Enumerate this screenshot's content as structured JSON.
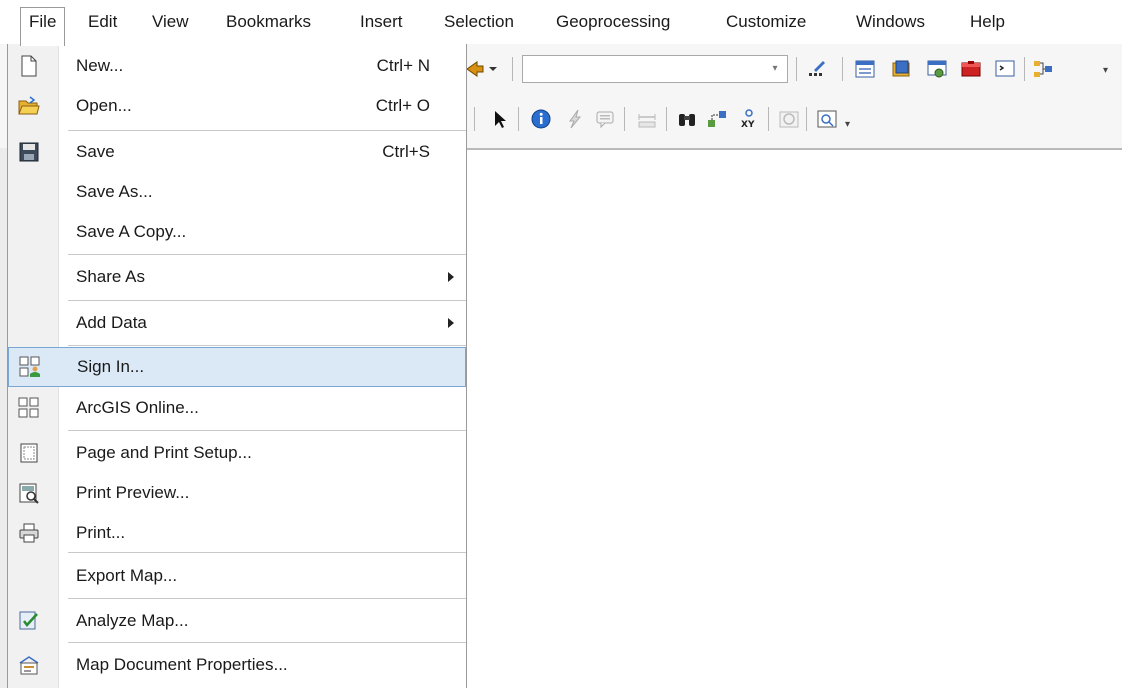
{
  "menubar": {
    "items": [
      "File",
      "Edit",
      "View",
      "Bookmarks",
      "Insert",
      "Selection",
      "Geoprocessing",
      "Customize",
      "Windows",
      "Help"
    ]
  },
  "toolbar": {
    "combo_value": ""
  },
  "file_menu": {
    "items": [
      {
        "label": "New...",
        "shortcut": "Ctrl+ N",
        "icon": "new-document-icon"
      },
      {
        "label": "Open...",
        "shortcut": "Ctrl+ O",
        "icon": "open-folder-icon"
      },
      {
        "label": "Save",
        "shortcut": "Ctrl+S",
        "icon": "save-disk-icon"
      },
      {
        "label": "Save As...",
        "shortcut": "",
        "icon": ""
      },
      {
        "label": "Save A Copy...",
        "shortcut": "",
        "icon": ""
      },
      {
        "label": "Share As",
        "shortcut": "",
        "icon": "",
        "submenu": true
      },
      {
        "label": "Add Data",
        "shortcut": "",
        "icon": "",
        "submenu": true
      },
      {
        "label": "Sign In...",
        "shortcut": "",
        "icon": "sign-in-icon",
        "highlighted": true
      },
      {
        "label": "ArcGIS Online...",
        "shortcut": "",
        "icon": "arcgis-online-icon"
      },
      {
        "label": "Page and Print Setup...",
        "shortcut": "",
        "icon": "page-setup-icon"
      },
      {
        "label": "Print Preview...",
        "shortcut": "",
        "icon": "print-preview-icon"
      },
      {
        "label": "Print...",
        "shortcut": "",
        "icon": "printer-icon"
      },
      {
        "label": "Export Map...",
        "shortcut": "",
        "icon": ""
      },
      {
        "label": "Analyze Map...",
        "shortcut": "",
        "icon": "analyze-map-icon"
      },
      {
        "label": "Map Document Properties...",
        "shortcut": "",
        "icon": "document-properties-icon"
      }
    ]
  },
  "colors": {
    "highlight_bg": "#dbe9f7",
    "highlight_border": "#7aa6d6"
  }
}
